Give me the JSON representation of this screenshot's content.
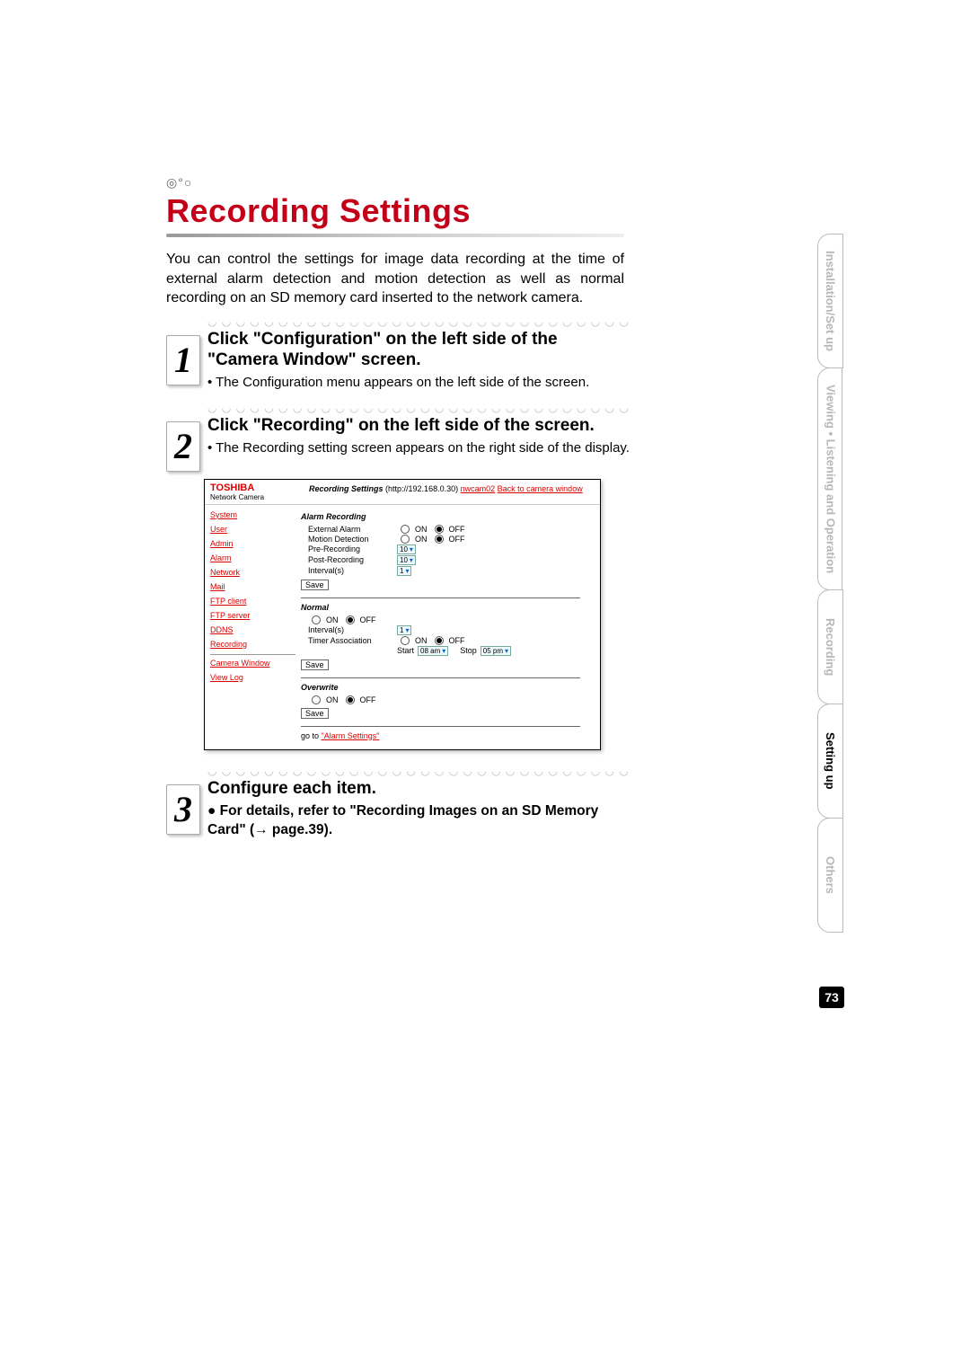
{
  "header": {
    "circles": "◎°○",
    "title": "Recording Settings",
    "intro": "You can control the settings for image data recording at the time of external alarm detection and motion detection as well as normal recording on an SD memory card inserted to the network camera."
  },
  "steps": [
    {
      "num": "1",
      "title": "Click \"Configuration\" on the left side of the \"Camera Window\" screen.",
      "bullets": [
        "• The Configuration menu appears on the left side of the screen."
      ]
    },
    {
      "num": "2",
      "title": "Click \"Recording\" on the left side of the screen.",
      "bullets": [
        "• The Recording setting screen appears on the right side of the display."
      ]
    },
    {
      "num": "3",
      "title": "Configure each item.",
      "sub": "● For details, refer to \"Recording Images on an SD Memory Card\" (→ page.39)."
    }
  ],
  "shot": {
    "brand": "TOSHIBA",
    "brand_sub": "Network Camera",
    "crumb": {
      "title": "Recording Settings",
      "url_prefix": "(http://192.168.0.30)",
      "cam": "nwcam02",
      "back": "Back to camera window"
    },
    "nav": [
      "System",
      "User",
      "Admin",
      "Alarm",
      "Network",
      "Mail",
      "FTP client",
      "FTP server",
      "DDNS",
      "Recording",
      "Camera Window",
      "View Log"
    ],
    "alarm": {
      "title": "Alarm Recording",
      "rows": [
        {
          "label": "External Alarm",
          "on": "ON",
          "off": "OFF",
          "sel": "off"
        },
        {
          "label": "Motion Detection",
          "on": "ON",
          "off": "OFF",
          "sel": "off"
        },
        {
          "label": "Pre-Recording",
          "value": "10"
        },
        {
          "label": "Post-Recording",
          "value": "10"
        },
        {
          "label": "Interval(s)",
          "value": "1"
        }
      ],
      "save": "Save"
    },
    "normal": {
      "title": "Normal",
      "onoff": {
        "on": "ON",
        "off": "OFF",
        "sel": "off"
      },
      "interval": {
        "label": "Interval(s)",
        "value": "1"
      },
      "timer": {
        "label": "Timer Association",
        "on": "ON",
        "off": "OFF",
        "sel": "off"
      },
      "start": {
        "label": "Start",
        "value": "08 am"
      },
      "stop": {
        "label": "Stop",
        "value": "05 pm"
      },
      "save": "Save"
    },
    "overwrite": {
      "title": "Overwrite",
      "on": "ON",
      "off": "OFF",
      "sel": "off",
      "save": "Save"
    },
    "goto": {
      "prefix": "go to ",
      "link": "\"Alarm Settings\""
    }
  },
  "tabs": [
    "Installation/Set up",
    "Viewing • Listening\nand Operation",
    "Recording",
    "Setting up",
    "Others"
  ],
  "tabs_active_index": 3,
  "page_number": "73",
  "dotrow": "◡ ◡ ◡ ◡ ◡ ◡ ◡ ◡ ◡ ◡ ◡ ◡ ◡ ◡ ◡ ◡ ◡ ◡ ◡ ◡ ◡ ◡ ◡ ◡ ◡ ◡ ◡ ◡ ◡ ◡ ◡ ◡ ◡ ◡ ◡ ◡ ◡ ◡ ◡ ◡ ◡"
}
